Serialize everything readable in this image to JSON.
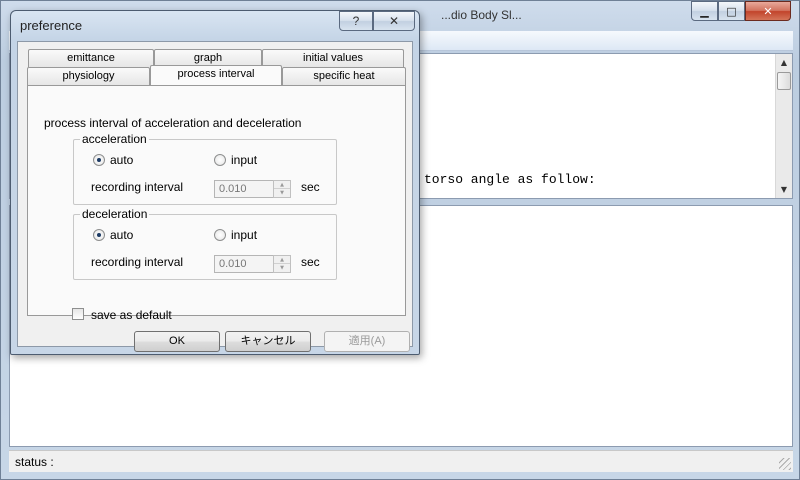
{
  "main_window": {
    "title": "...dio Body Sl...",
    "minimize_glyph": "▁",
    "maximize_glyph": "□",
    "close_glyph": "✕",
    "upper_text": "torso angle as follow:",
    "scroll_up_glyph": "▲",
    "scroll_down_glyph": "▼",
    "status_label": "status :"
  },
  "dialog": {
    "title": "preference",
    "help_glyph": "?",
    "close_glyph": "✕",
    "tabs_row1": [
      "emittance",
      "graph",
      "initial values"
    ],
    "tabs_row2": [
      "physiology",
      "process interval",
      "specific heat"
    ],
    "active_tab": "process interval",
    "section_title": "process interval of acceleration and deceleration",
    "acceleration": {
      "group_label": "acceleration",
      "radio_auto": "auto",
      "radio_input": "input",
      "selected": "auto",
      "interval_label": "recording interval",
      "interval_value": "0.010",
      "unit": "sec"
    },
    "deceleration": {
      "group_label": "deceleration",
      "radio_auto": "auto",
      "radio_input": "input",
      "selected": "auto",
      "interval_label": "recording interval",
      "interval_value": "0.010",
      "unit": "sec"
    },
    "save_default_label": "save as default",
    "save_default_checked": false,
    "buttons": {
      "ok": "OK",
      "cancel": "キャンセル",
      "apply": "適用(A)"
    },
    "spin_up_glyph": "▲",
    "spin_down_glyph": "▼"
  }
}
